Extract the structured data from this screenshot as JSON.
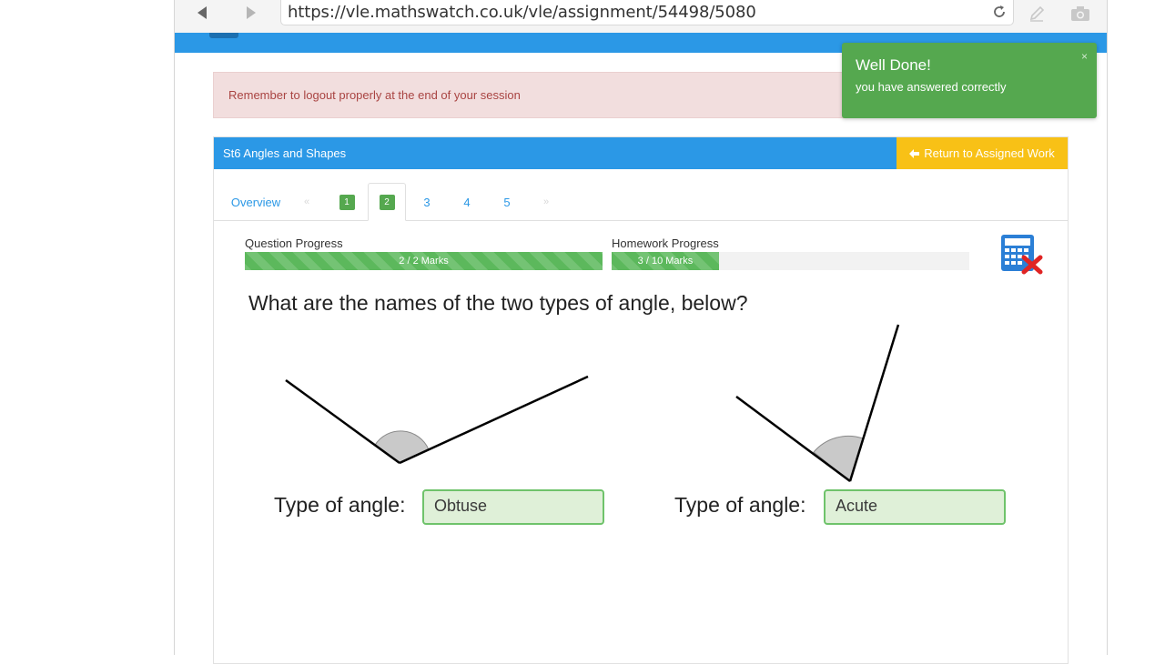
{
  "browser": {
    "url": "https://vle.mathswatch.co.uk/vle/assignment/54498/5080",
    "icons": [
      "back-arrow-icon",
      "forward-arrow-icon",
      "reload-icon",
      "pencil-icon",
      "camera-icon"
    ]
  },
  "alert": {
    "text": "Remember to logout properly at the end of your session"
  },
  "toast": {
    "title": "Well Done!",
    "message": "you have answered correctly",
    "close": "×",
    "color": "#55a84f"
  },
  "panel": {
    "title": "St6 Angles and Shapes",
    "return_label": "Return to Assigned Work",
    "header_color": "#2b98e6",
    "return_color": "#f8c116"
  },
  "tabs": {
    "overview": "Overview",
    "prev": "«",
    "next": "»",
    "items": [
      {
        "label": "1",
        "state": "done"
      },
      {
        "label": "2",
        "state": "done-active"
      },
      {
        "label": "3",
        "state": "pending"
      },
      {
        "label": "4",
        "state": "pending"
      },
      {
        "label": "5",
        "state": "pending"
      }
    ]
  },
  "progress": {
    "question": {
      "label": "Question Progress",
      "text": "2 / 2 Marks",
      "value": 2,
      "max": 2
    },
    "homework": {
      "label": "Homework Progress",
      "text": "3 / 10 Marks",
      "value": 3,
      "max": 10
    }
  },
  "question": {
    "text": "What are the names of the two types of angle, below?",
    "answers": [
      {
        "label": "Type of angle:",
        "value": "Obtuse"
      },
      {
        "label": "Type of angle:",
        "value": "Acute"
      }
    ]
  }
}
